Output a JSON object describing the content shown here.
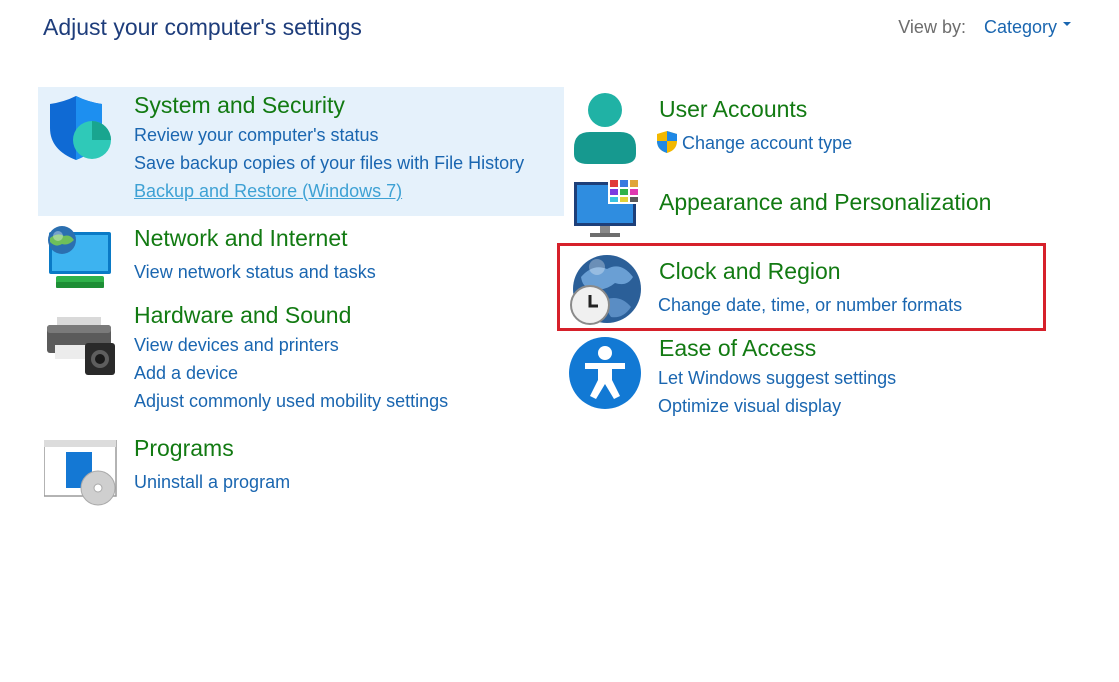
{
  "page": {
    "title": "Adjust your computer's settings"
  },
  "view_by": {
    "label": "View by:",
    "value": "Category"
  },
  "left_categories": [
    {
      "title": "System and Security",
      "links": [
        "Review your computer's status",
        "Save backup copies of your files with File History",
        "Backup and Restore (Windows 7)"
      ]
    },
    {
      "title": "Network and Internet",
      "links": [
        "View network status and tasks"
      ]
    },
    {
      "title": "Hardware and Sound",
      "links": [
        "View devices and printers",
        "Add a device",
        "Adjust commonly used mobility settings"
      ]
    },
    {
      "title": "Programs",
      "links": [
        "Uninstall a program"
      ]
    }
  ],
  "right_categories": [
    {
      "title": "User Accounts",
      "links": [
        "Change account type"
      ]
    },
    {
      "title": "Appearance and Personalization",
      "links": []
    },
    {
      "title": "Clock and Region",
      "links": [
        "Change date, time, or number formats"
      ]
    },
    {
      "title": "Ease of Access",
      "links": [
        "Let Windows suggest settings",
        "Optimize visual display"
      ]
    }
  ],
  "colors": {
    "heading": "#127a12",
    "link": "#1a66b0",
    "hover": "#e5f1fb",
    "highlight": "#d6202a"
  },
  "icons": [
    "shield-icon",
    "network-icon",
    "printer-icon",
    "programs-icon",
    "user-icon",
    "uac-shield-icon",
    "appearance-icon",
    "clock-globe-icon",
    "ease-of-access-icon"
  ]
}
